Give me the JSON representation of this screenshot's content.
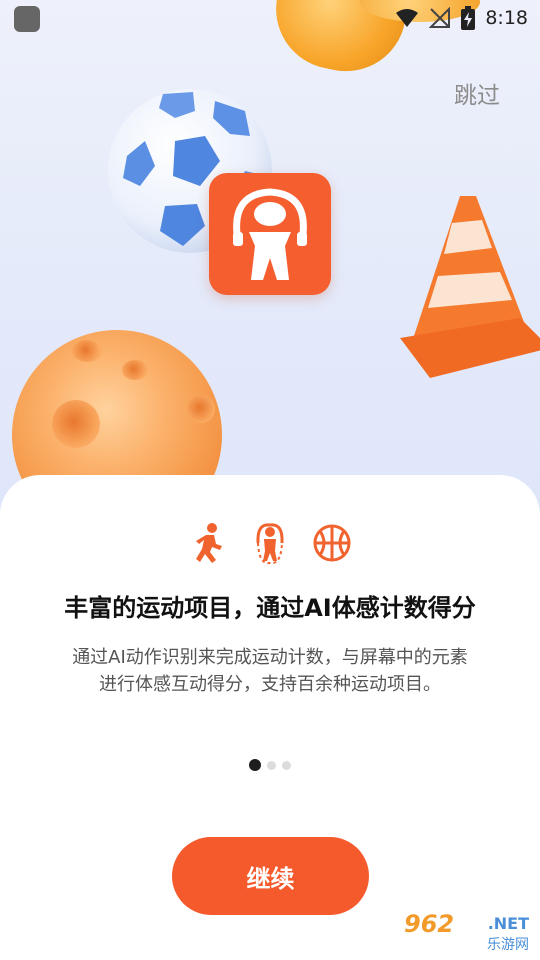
{
  "status_bar": {
    "time": "8:18"
  },
  "header": {
    "skip_label": "跳过"
  },
  "onboarding": {
    "headline": "丰富的运动项目，通过AI体感计数得分",
    "description_line1": "通过AI动作识别来完成运动计数，与屏幕中的元素",
    "description_line2": "进行体感互动得分，支持百余种运动项目。",
    "feature_icons": [
      "running-icon",
      "jump-rope-icon",
      "basketball-icon"
    ],
    "pager": {
      "total": 3,
      "active_index": 0
    },
    "continue_label": "继续"
  },
  "watermark": {
    "main": "962",
    "sub": ".NET",
    "sub2": "乐游网"
  },
  "colors": {
    "accent": "#f55a2c",
    "icon_orange": "#f0632f"
  }
}
